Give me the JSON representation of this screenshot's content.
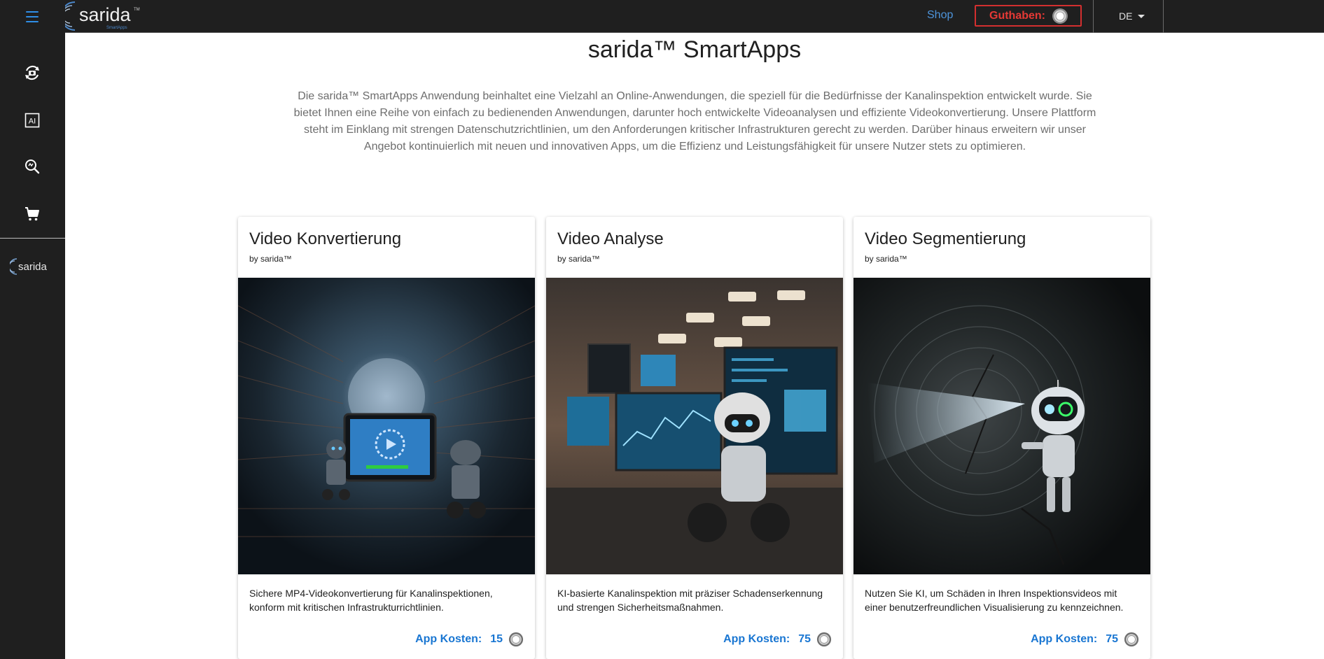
{
  "header": {
    "logo_text": "sarida",
    "logo_sub": "SmartApps",
    "logo_tm": "TM",
    "shop_label": "Shop",
    "credit_label": "Guthaben:",
    "language": "DE"
  },
  "sidebar": {
    "icons": [
      "rotate-camera-icon",
      "ai-icon",
      "zoom-search-icon",
      "cart-icon"
    ],
    "logo_text": "sarida"
  },
  "main": {
    "title": "sarida™ SmartApps",
    "intro": "Die sarida™ SmartApps Anwendung beinhaltet eine Vielzahl an Online-Anwendungen, die speziell für die Bedürfnisse der Kanalinspektion entwickelt wurde. Sie bietet Ihnen eine Reihe von einfach zu bedienenden Anwendungen, darunter hoch entwickelte Videoanalysen und effiziente Videokonvertierung. Unsere Plattform steht im Einklang mit strengen Datenschutzrichtlinien, um den Anforderungen kritischer Infrastrukturen gerecht zu werden. Darüber hinaus erweitern wir unser Angebot kontinuierlich mit neuen und innovativen Apps, um die Effizienz und Leistungsfähigkeit für unsere Nutzer stets zu optimieren."
  },
  "cards": [
    {
      "title": "Video Konvertierung",
      "by": "by sarida™",
      "desc": "Sichere MP4-Videokonvertierung für Kanalinspektionen, konform mit kritischen Infrastrukturrichtlinien.",
      "cost_label": "App Kosten:",
      "cost": "15"
    },
    {
      "title": "Video Analyse",
      "by": "by sarida™",
      "desc": "KI-basierte Kanalinspektion mit präziser Schadenserkennung und strengen Sicherheitsmaßnahmen.",
      "cost_label": "App Kosten:",
      "cost": "75"
    },
    {
      "title": "Video Segmentierung",
      "by": "by sarida™",
      "desc": "Nutzen Sie KI, um Schäden in Ihren Inspektionsvideos mit einer benutzerfreundlichen Visualisierung zu kennzeichnen.",
      "cost_label": "App Kosten:",
      "cost": "75"
    }
  ],
  "colors": {
    "chrome": "#1f1f1f",
    "accent": "#1976d2",
    "credit": "#e53935"
  }
}
